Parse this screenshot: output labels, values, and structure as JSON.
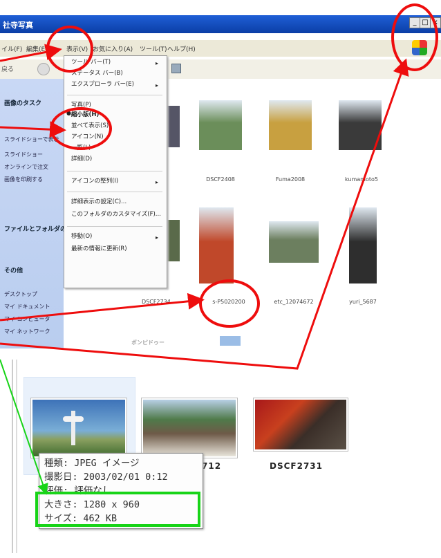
{
  "window": {
    "title": "社寺写真",
    "min": "_",
    "max": "□",
    "close": "x"
  },
  "menubar": [
    "イル(F)",
    "編集(E)",
    "表示(V)",
    "お気に入り(A)",
    "ツール(T)",
    "ヘルプ(H)"
  ],
  "toolbar": {
    "back": "戻る",
    "forward": "→"
  },
  "leftpane": {
    "tasks_title": "画像のタスク",
    "tasks": [
      "スライドショーで表示",
      "オンラインで注文",
      "画像を印刷する",
      "スライドショー"
    ],
    "file_title": "ファイルとフォルダのタスク",
    "other_title": "その他",
    "places": [
      "デスクトップ",
      "マイ ドキュメント",
      "マイ コンピュータ",
      "マイ ネットワーク"
    ]
  },
  "view_menu": {
    "items": [
      "ツール バー(T)",
      "ステータス バー(B)",
      "エクスプローラ バー(E)",
      "縮小版(H)",
      "並べて表示(S)",
      "アイコン(N)",
      "一覧(L)",
      "詳細(D)",
      "アイコンの整列(I)",
      "詳細表示の設定(C)...",
      "このフォルダのカスタマイズ(F)...",
      "移動(O)",
      "最新の情報に更新(R)"
    ],
    "top_item": "写真(P)",
    "selected": "縮小版(H)"
  },
  "thumbnails": [
    {
      "caption": "DSCF2408",
      "color": "#6b8e5a"
    },
    {
      "caption": "Fuma2008",
      "color": "#c8a040"
    },
    {
      "caption": "kumamoto5",
      "color": "#3a3a3a"
    },
    {
      "caption": "s-P5020200",
      "color": "#c0482a"
    },
    {
      "caption": "etc_12074672",
      "color": "#6c7f5f"
    },
    {
      "caption": "yuri_5687",
      "color": "#2e2e2e"
    }
  ],
  "partial_captions": [
    "ポンピドゥー",
    "DSCF2734"
  ],
  "bottom": {
    "photos": [
      {
        "caption": "",
        "color": "#5f8aa8"
      },
      {
        "caption": "712",
        "color": "#7aa07a"
      },
      {
        "caption": "DSCF2731",
        "color": "#7a2a20"
      }
    ],
    "tooltip": {
      "type": "種類: JPEG イメージ",
      "date": "撮影日: 2003/02/01 0:12",
      "rating": "評価: 評価なし",
      "dimensions": "大きさ: 1280 x 960",
      "size": "サイズ: 462 KB"
    }
  },
  "annotation_colors": {
    "circle": "#ee0d0d",
    "green_box": "#18d418"
  }
}
